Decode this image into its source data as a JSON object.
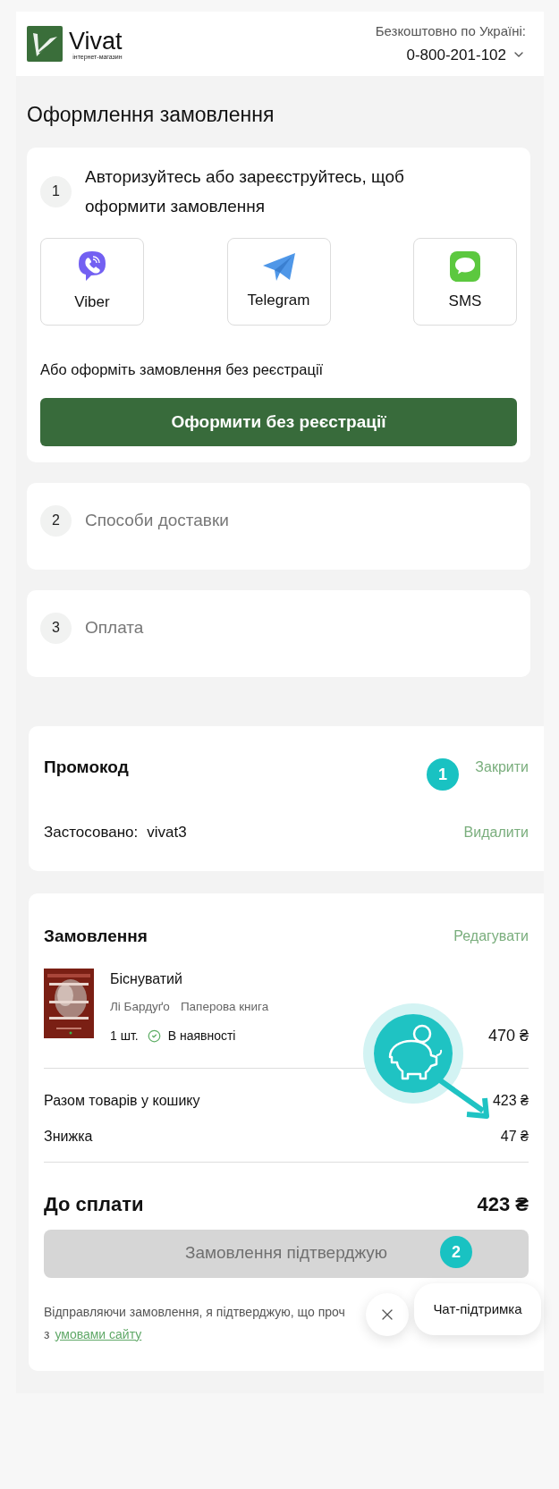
{
  "header": {
    "logo_name": "Vivat",
    "logo_tagline": "інтернет-магазин",
    "phone_label": "Безкоштовно по Україні:",
    "phone": "0-800-201-102"
  },
  "page_title": "Оформлення замовлення",
  "steps": [
    {
      "number": "1",
      "title": "Авторизуйтесь або зареєструйтесь, щоб оформити замовлення",
      "expanded": true
    },
    {
      "number": "2",
      "title": "Способи доставки",
      "expanded": false
    },
    {
      "number": "3",
      "title": "Оплата",
      "expanded": false
    }
  ],
  "auth": {
    "options": [
      {
        "kind": "viber",
        "label": "Viber"
      },
      {
        "kind": "telegram",
        "label": "Telegram"
      },
      {
        "kind": "sms",
        "label": "SMS"
      }
    ],
    "guest_text": "Або оформіть замовлення без реєстрації",
    "guest_button": "Оформити без реєстрації"
  },
  "promo": {
    "title": "Промокод",
    "close_link": "Закрити",
    "applied_label": "Застосовано:",
    "code": "vivat3",
    "remove_link": "Видалити"
  },
  "order": {
    "title": "Замовлення",
    "edit_link": "Редагувати",
    "items": [
      {
        "title": "Біснуватий",
        "author": "Лі Бардуґо",
        "format": "Паперова книга",
        "quantity": "1 шт.",
        "availability": "В наявності",
        "price": "470 ₴"
      }
    ],
    "subtotal_label": "Разом товарів у кошику",
    "subtotal": "423 ₴",
    "discount_label": "Знижка",
    "discount": "47 ₴",
    "total_label": "До сплати",
    "total": "423 ₴",
    "confirm_button": {
      "label": "Замовлення підтверджую",
      "disabled": true
    },
    "consent_text": "Відправляючи замовлення, я підтверджую, що проч",
    "consent_prefix": "з",
    "consent_link": "умовами сайту"
  },
  "chat": {
    "label": "Чат-підтримка"
  },
  "annotations": [
    {
      "label": "1"
    },
    {
      "label": "2"
    }
  ]
}
